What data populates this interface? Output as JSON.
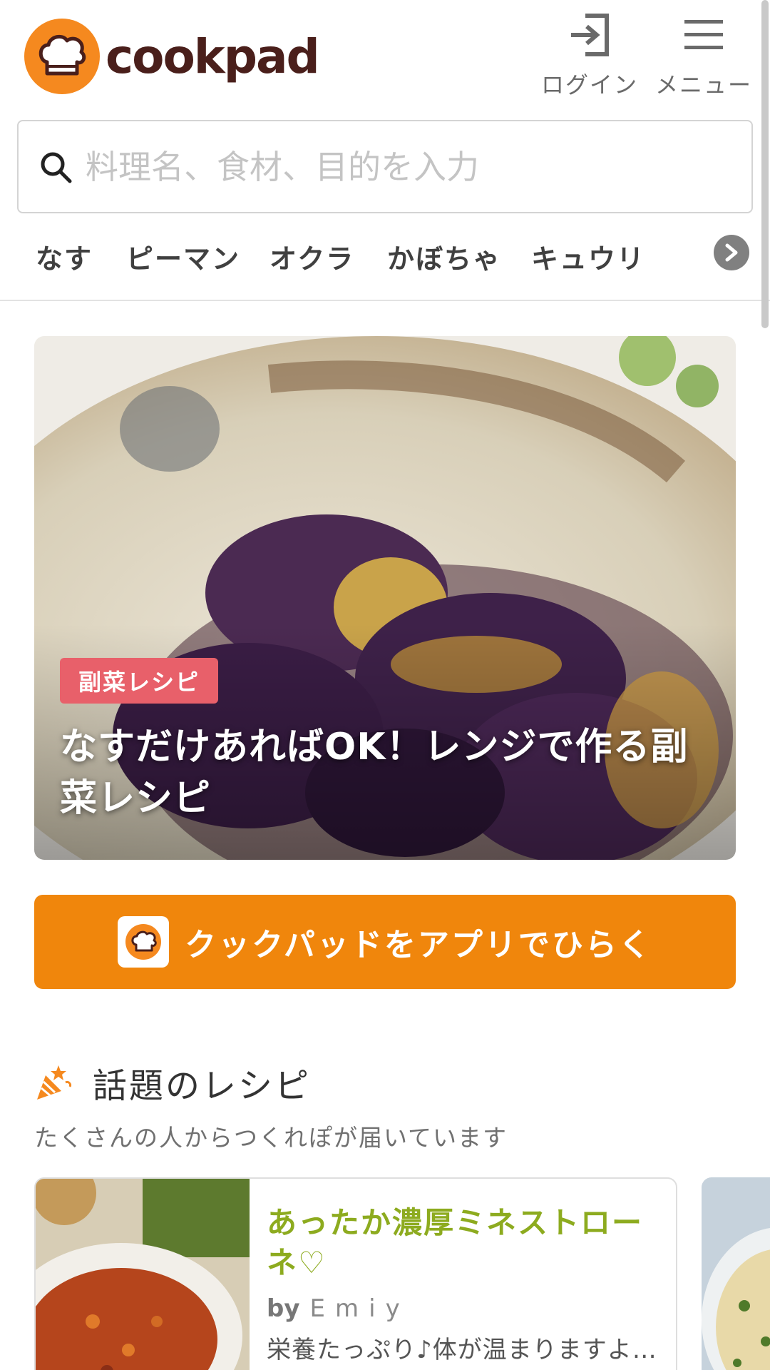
{
  "brand": {
    "name": "cookpad",
    "accent": "#f5891f",
    "app_button_color": "#f0860c"
  },
  "header": {
    "login_label": "ログイン",
    "menu_label": "メニュー",
    "login_icon": "login-icon",
    "menu_icon": "hamburger-icon"
  },
  "search": {
    "placeholder": "料理名、食材、目的を入力",
    "value": ""
  },
  "keywords": [
    "なす",
    "ピーマン",
    "オクラ",
    "かぼちゃ",
    "キュウリ"
  ],
  "hero": {
    "tag": "副菜レシピ",
    "title": "なすだけあればOK！レンジで作る副菜レシピ",
    "tag_color": "#e8606a"
  },
  "app_button": {
    "label": "クックパッドをアプリでひらく"
  },
  "trending": {
    "icon": "party-popper-icon",
    "title": "話題のレシピ",
    "subtitle": "たくさんの人からつくれぽが届いています",
    "cards": [
      {
        "title": "あったか濃厚ミネストローネ♡",
        "by": "by",
        "author": "Emiy",
        "description": "栄養たっぷり♪体が温まりますよ…",
        "title_color": "#8dab1f"
      }
    ]
  }
}
